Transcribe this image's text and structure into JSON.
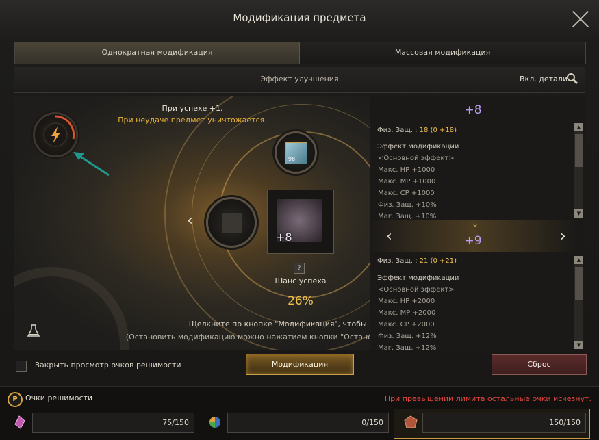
{
  "window": {
    "title": "Модификация предмета"
  },
  "tabs": [
    {
      "label": "Однократная модификация",
      "active": true
    },
    {
      "label": "Массовая модификация",
      "active": false
    }
  ],
  "effect_bar": {
    "title": "Эффект улучшения",
    "details_label": "Вкл. детали"
  },
  "stage": {
    "success_text": "При успехе +1.",
    "failure_text": "При неудаче предмет уничтожается.",
    "material_count": "98",
    "item_level": "+8",
    "chance_label": "Шанс успеха",
    "chance_value": "26%",
    "hint_line1": "Щелкните по кнопке \"Модификация\", чтобы начать м",
    "hint_line2": "(Остановить модификацию можно нажатием кнопки \"Остановить\"С.)"
  },
  "current": {
    "level": "+8",
    "stat_name": "Физ. Защ. :",
    "stat_value": "18",
    "stat_delta": "(0 +18)",
    "effect_header": "Эффект модификации",
    "effect_group": "<Основной эффект>",
    "effects": [
      "Макс. HP +1000",
      "Макс. MP +1000",
      "Макс. CP +1000",
      "Физ. Защ. +10%",
      "Маг. Защ. +10%"
    ]
  },
  "next": {
    "level": "+9",
    "stat_name": "Физ. Защ. :",
    "stat_value": "21",
    "stat_delta": "(0 +21)",
    "effect_header": "Эффект модификации",
    "effect_group": "<Основной эффект>",
    "effects": [
      "Макс. HP +2000",
      "Макс. MP +2000",
      "Макс. CP +2000",
      "Физ. Защ. +12%",
      "Маг. Защ. +12%"
    ]
  },
  "controls": {
    "close_points_label": "Закрыть просмотр очков решимости",
    "modify_button": "Модификация",
    "reset_button": "Сброс"
  },
  "points": {
    "coin_letter": "P",
    "label": "Очки решимости",
    "warning": "При превышении лимита остальные очки исчезнут.",
    "slots": [
      {
        "icon": "pink-crystal-icon",
        "value": "75/150"
      },
      {
        "icon": "rainbow-gem-icon",
        "value": "0/150"
      },
      {
        "icon": "bronze-emblem-icon",
        "value": "150/150",
        "highlighted": true
      }
    ]
  },
  "colors": {
    "accent_gold": "#f2c04a",
    "level_purple": "#b89af0",
    "warning_red": "#e0453e"
  }
}
